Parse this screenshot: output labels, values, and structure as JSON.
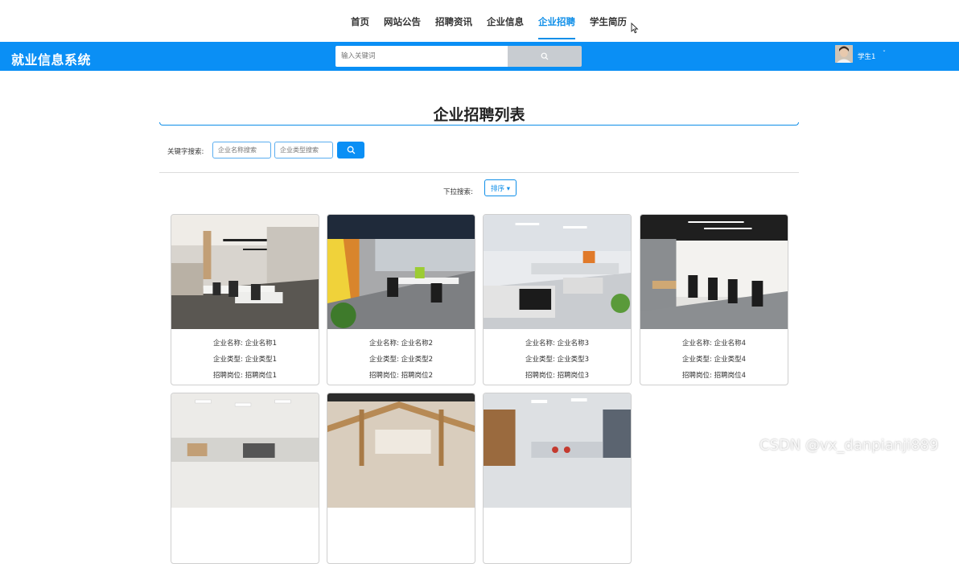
{
  "nav": {
    "items": [
      "首页",
      "网站公告",
      "招聘资讯",
      "企业信息",
      "企业招聘",
      "学生简历"
    ],
    "active_index": 4
  },
  "header": {
    "brand": "就业信息系统",
    "search_placeholder": "输入关键词",
    "username": "学生1",
    "user_caret": "ˇ"
  },
  "main": {
    "title": "企业招聘列表",
    "keyword_label": "关键字搜索:",
    "company_name_placeholder": "企业名称搜索",
    "company_type_placeholder": "企业类型搜索",
    "dropdown_label": "下拉搜索:",
    "sort_label": "排序 ▾"
  },
  "cards": [
    {
      "name": "企业名称: 企业名称1",
      "type": "企业类型: 企业类型1",
      "position": "招聘岗位: 招聘岗位1"
    },
    {
      "name": "企业名称: 企业名称2",
      "type": "企业类型: 企业类型2",
      "position": "招聘岗位: 招聘岗位2"
    },
    {
      "name": "企业名称: 企业名称3",
      "type": "企业类型: 企业类型3",
      "position": "招聘岗位: 招聘岗位3"
    },
    {
      "name": "企业名称: 企业名称4",
      "type": "企业类型: 企业类型4",
      "position": "招聘岗位: 招聘岗位4"
    },
    {
      "name": "",
      "type": "",
      "position": ""
    },
    {
      "name": "",
      "type": "",
      "position": ""
    },
    {
      "name": "",
      "type": "",
      "position": ""
    }
  ],
  "watermark": "CSDN @vx_danpianji889",
  "colors": {
    "primary": "#0a8ff5",
    "active_nav": "#0e8ee8",
    "search_button": "#c8ccd1"
  },
  "icons": {
    "search": "search-icon",
    "cursor": "mouse-cursor-icon",
    "avatar": "user-avatar"
  }
}
